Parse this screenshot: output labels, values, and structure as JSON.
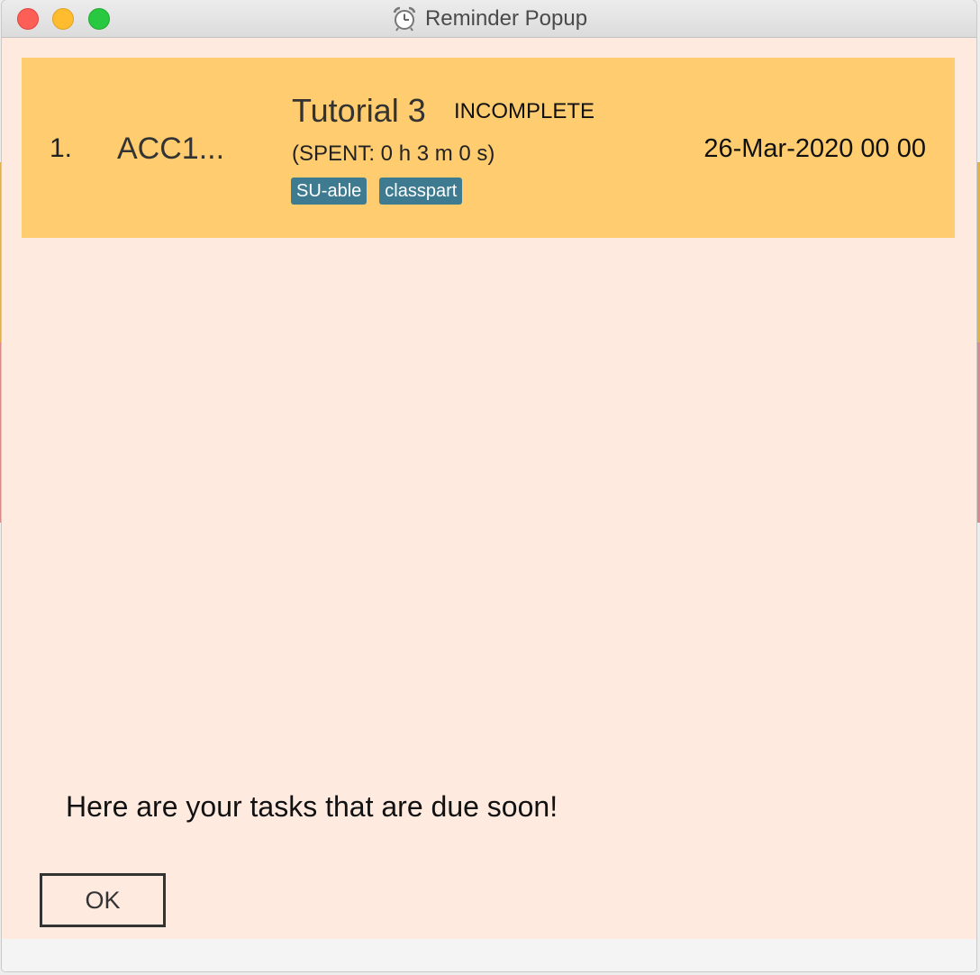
{
  "window": {
    "title": "Reminder Popup",
    "icon": "alarm-clock-icon"
  },
  "task": {
    "index": "1.",
    "module": "ACC1...",
    "name": "Tutorial 3",
    "status": "INCOMPLETE",
    "spent": "(SPENT: 0 h 3 m 0 s)",
    "tags": [
      "SU-able",
      "classpart"
    ],
    "date": "26-Mar-2020 00 00"
  },
  "message": "Here are your tasks that are due soon!",
  "ok_label": "OK",
  "colors": {
    "card": "#ffcd70",
    "background": "#ffeadf",
    "tag": "#3e7b91"
  }
}
